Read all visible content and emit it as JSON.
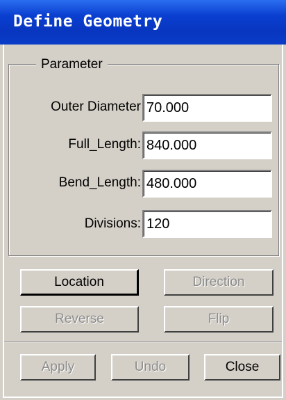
{
  "window": {
    "title": "Define Geometry"
  },
  "parameter_group": {
    "legend": "Parameter",
    "fields": [
      {
        "label": "Outer Diameter",
        "value": "70.000"
      },
      {
        "label": "Full_Length:",
        "value": "840.000"
      },
      {
        "label": "Bend_Length:",
        "value": "480.000"
      },
      {
        "label": "Divisions:",
        "value": "120"
      }
    ]
  },
  "buttons": {
    "location": {
      "label": "Location",
      "enabled": true
    },
    "direction": {
      "label": "Direction",
      "enabled": false
    },
    "reverse": {
      "label": "Reverse",
      "enabled": false
    },
    "flip": {
      "label": "Flip",
      "enabled": false
    },
    "apply": {
      "label": "Apply",
      "enabled": false
    },
    "undo": {
      "label": "Undo",
      "enabled": false
    },
    "close": {
      "label": "Close",
      "enabled": true
    }
  },
  "colors": {
    "titlebar": "#0a3fd0",
    "dialog_bg": "#d4d0c8",
    "disabled_text": "#8c8c8c"
  }
}
